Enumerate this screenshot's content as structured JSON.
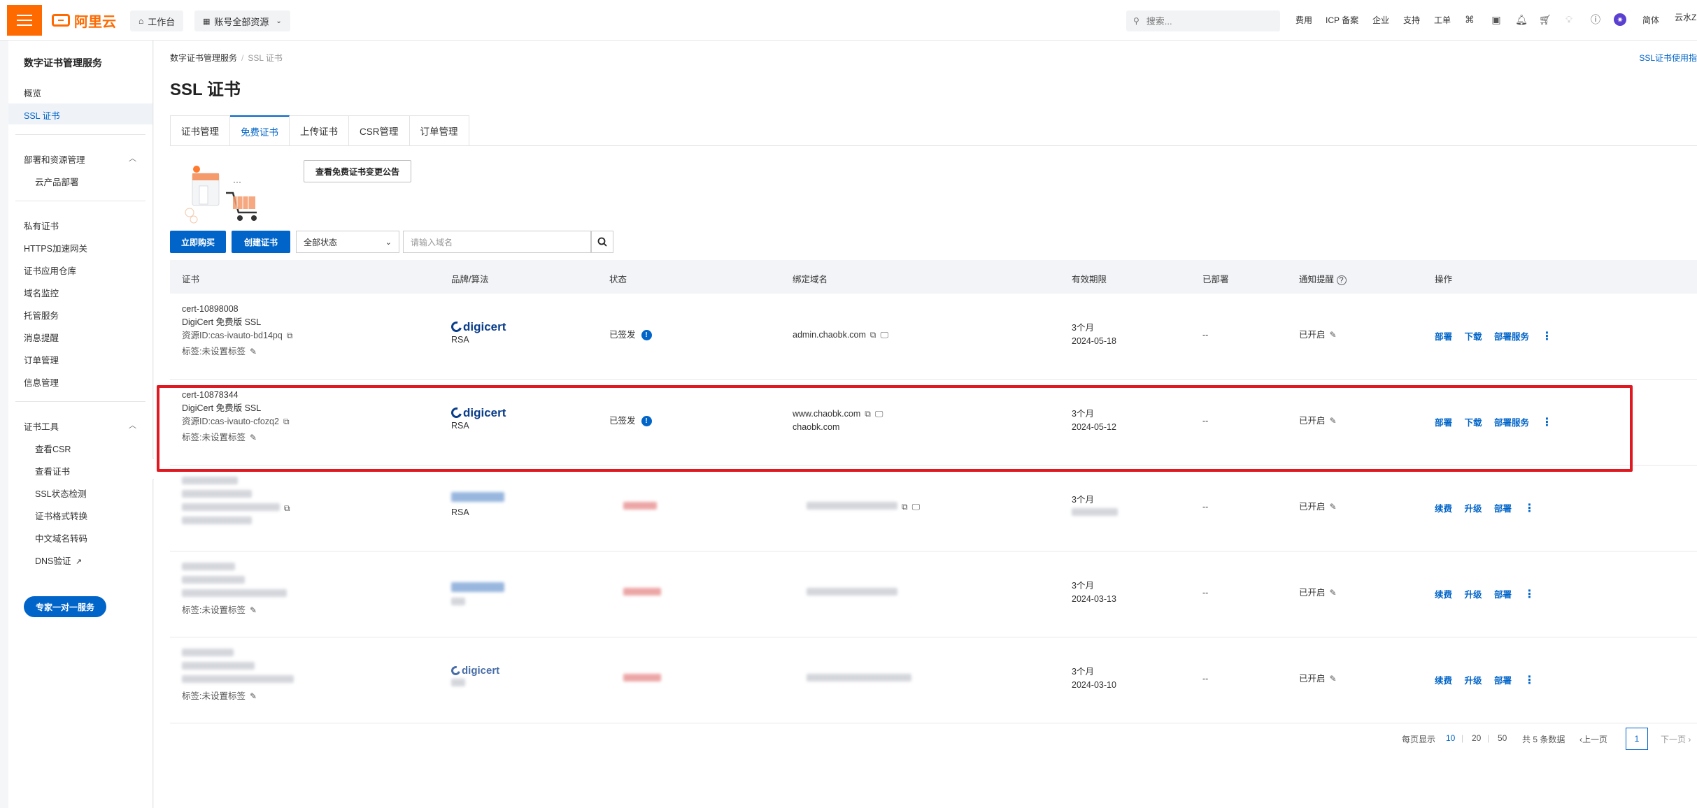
{
  "topbar": {
    "brand": "阿里云",
    "workbench": "工作台",
    "account_scope": "账号全部资源",
    "search_placeholder": "搜索...",
    "nav": [
      "费用",
      "ICP 备案",
      "企业",
      "支持",
      "工单"
    ],
    "lang": "简体",
    "user": "云水Z"
  },
  "sidebar": {
    "title": "数字证书管理服务",
    "items_top": [
      "概览",
      "SSL 证书"
    ],
    "group_deploy": "部署和资源管理",
    "deploy_sub": [
      "云产品部署"
    ],
    "items_mid": [
      "私有证书",
      "HTTPS加速网关",
      "证书应用仓库",
      "域名监控",
      "托管服务",
      "消息提醒",
      "订单管理",
      "信息管理"
    ],
    "group_tools": "证书工具",
    "tools_sub": [
      "查看CSR",
      "查看证书",
      "SSL状态检测",
      "证书格式转换",
      "中文域名转码",
      "DNS验证"
    ],
    "expert_button": "专家一对一服务"
  },
  "main": {
    "breadcrumb": [
      "数字证书管理服务",
      "SSL 证书"
    ],
    "help_link": "SSL证书使用指",
    "title": "SSL 证书",
    "tabs": [
      "证书管理",
      "免费证书",
      "上传证书",
      "CSR管理",
      "订单管理"
    ],
    "notice_button": "查看免费证书变更公告",
    "buy_button": "立即购买",
    "create_button": "创建证书",
    "status_filter": "全部状态",
    "domain_placeholder": "请输入域名"
  },
  "table": {
    "headers": [
      "证书",
      "品牌/算法",
      "状态",
      "绑定域名",
      "有效期限",
      "已部署",
      "通知提醒",
      "操作"
    ],
    "rows": [
      {
        "cert_id": "cert-10898008",
        "cert_name": "DigiCert 免费版 SSL",
        "resource_id": "资源ID:cas-ivauto-bd14pq",
        "tag": "标签:未设置标签",
        "brand": "digicert",
        "algorithm": "RSA",
        "status": "已签发",
        "domains": [
          "admin.chaobk.com"
        ],
        "validity": "3个月",
        "expiry": "2024-05-18",
        "deployed": "--",
        "notify": "已开启",
        "actions": [
          "部署",
          "下载",
          "部署服务"
        ]
      },
      {
        "cert_id": "cert-10878344",
        "cert_name": "DigiCert 免费版 SSL",
        "resource_id": "资源ID:cas-ivauto-cfozq2",
        "tag": "标签:未设置标签",
        "brand": "digicert",
        "algorithm": "RSA",
        "status": "已签发",
        "domains": [
          "www.chaobk.com",
          "chaobk.com"
        ],
        "validity": "3个月",
        "expiry": "2024-05-12",
        "deployed": "--",
        "notify": "已开启",
        "actions": [
          "部署",
          "下载",
          "部署服务"
        ]
      },
      {
        "algorithm": "RSA",
        "validity": "3个月",
        "deployed": "--",
        "notify": "已开启",
        "actions": [
          "续费",
          "升级",
          "部署"
        ]
      },
      {
        "tag": "标签:未设置标签",
        "validity": "3个月",
        "expiry": "2024-03-13",
        "deployed": "--",
        "notify": "已开启",
        "actions": [
          "续费",
          "升级",
          "部署"
        ]
      },
      {
        "brand": "digicert",
        "tag": "标签:未设置标签",
        "validity": "3个月",
        "expiry": "2024-03-10",
        "deployed": "--",
        "notify": "已开启",
        "actions": [
          "续费",
          "升级",
          "部署"
        ]
      }
    ]
  },
  "pagination": {
    "page_size_label": "每页显示",
    "sizes": [
      "10",
      "20",
      "50"
    ],
    "total": "共 5 条数据",
    "prev": "上一页",
    "current": "1",
    "next": "下一页"
  },
  "colors": {
    "accent": "#0064c8",
    "brand": "#ff6a00",
    "highlight": "#e0181f"
  }
}
